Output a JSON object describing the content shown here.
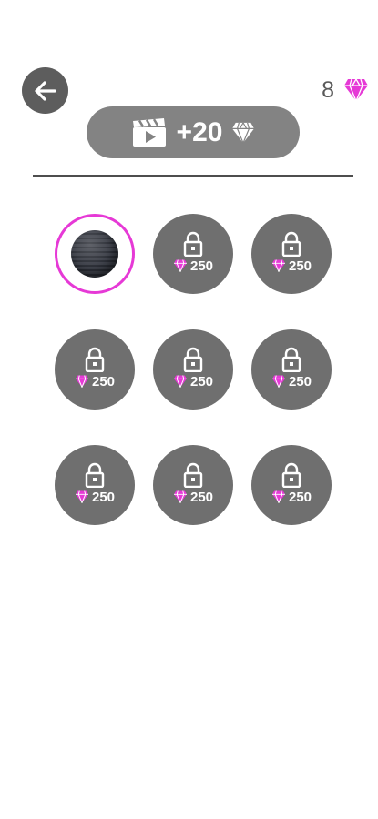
{
  "header": {
    "back_icon": "arrow-left-icon",
    "gem_count": "8",
    "gem_icon": "diamond-icon",
    "gem_color": "#e639d6"
  },
  "reward": {
    "video_icon": "clapperboard-play-icon",
    "amount": "+20",
    "gem_icon": "diamond-icon"
  },
  "skins": [
    {
      "state": "selected",
      "icon": "black-ball"
    },
    {
      "state": "locked",
      "price": "250"
    },
    {
      "state": "locked",
      "price": "250"
    },
    {
      "state": "locked",
      "price": "250"
    },
    {
      "state": "locked",
      "price": "250"
    },
    {
      "state": "locked",
      "price": "250"
    },
    {
      "state": "locked",
      "price": "250"
    },
    {
      "state": "locked",
      "price": "250"
    },
    {
      "state": "locked",
      "price": "250"
    }
  ],
  "colors": {
    "accent": "#e639d6",
    "item_bg": "#6f6f6f",
    "button_bg": "#838383"
  }
}
